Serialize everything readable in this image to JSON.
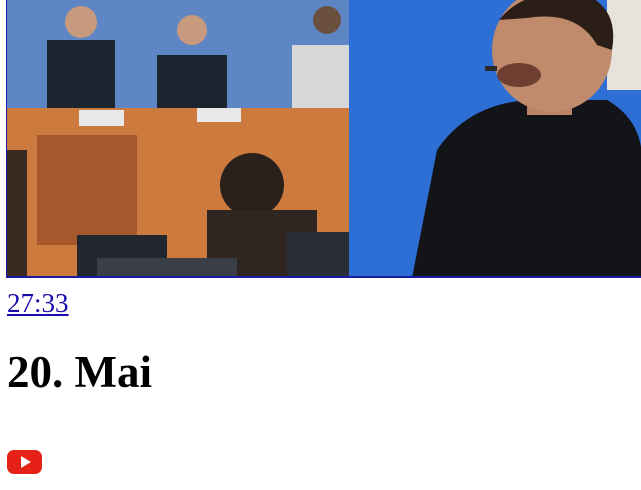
{
  "video": {
    "duration": "27:33",
    "title": "20. Mai",
    "thumbnail_icon": "video-thumbnail",
    "platform_icon": "youtube-icon",
    "platform_color": "#e62117",
    "link_color": "#1a0dab"
  }
}
